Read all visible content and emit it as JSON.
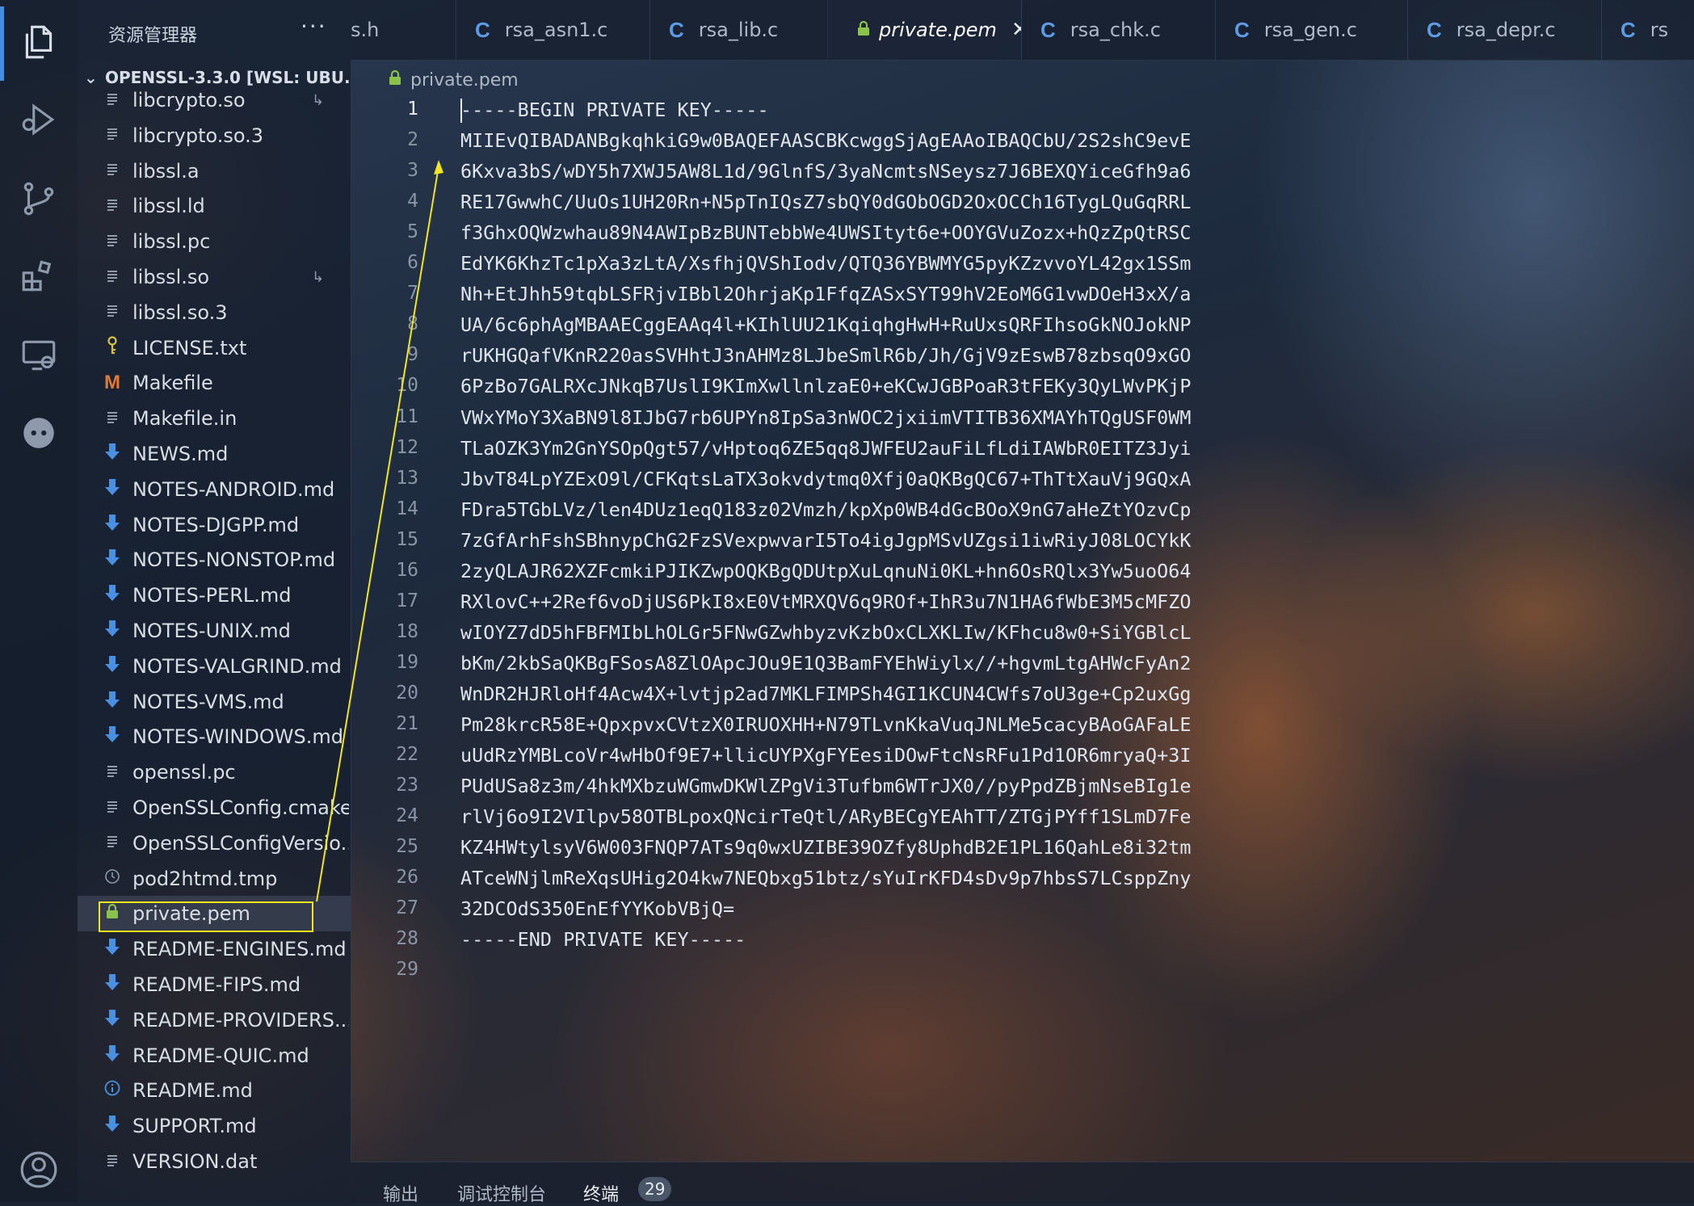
{
  "sidebar": {
    "title": "资源管理器",
    "more": "···",
    "workspace": "OPENSSL-3.3.0 [WSL: UBU...",
    "files": [
      {
        "name": "libcrypto.so",
        "icon": "text-file",
        "link": "↳"
      },
      {
        "name": "libcrypto.so.3",
        "icon": "text-file"
      },
      {
        "name": "libssl.a",
        "icon": "text-file"
      },
      {
        "name": "libssl.ld",
        "icon": "text-file"
      },
      {
        "name": "libssl.pc",
        "icon": "text-file"
      },
      {
        "name": "libssl.so",
        "icon": "text-file",
        "link": "↳"
      },
      {
        "name": "libssl.so.3",
        "icon": "text-file"
      },
      {
        "name": "LICENSE.txt",
        "icon": "license-key"
      },
      {
        "name": "Makefile",
        "icon": "makefile-m"
      },
      {
        "name": "Makefile.in",
        "icon": "text-file"
      },
      {
        "name": "NEWS.md",
        "icon": "markdown-arrow"
      },
      {
        "name": "NOTES-ANDROID.md",
        "icon": "markdown-arrow"
      },
      {
        "name": "NOTES-DJGPP.md",
        "icon": "markdown-arrow"
      },
      {
        "name": "NOTES-NONSTOP.md",
        "icon": "markdown-arrow"
      },
      {
        "name": "NOTES-PERL.md",
        "icon": "markdown-arrow"
      },
      {
        "name": "NOTES-UNIX.md",
        "icon": "markdown-arrow"
      },
      {
        "name": "NOTES-VALGRIND.md",
        "icon": "markdown-arrow"
      },
      {
        "name": "NOTES-VMS.md",
        "icon": "markdown-arrow"
      },
      {
        "name": "NOTES-WINDOWS.md",
        "icon": "markdown-arrow"
      },
      {
        "name": "openssl.pc",
        "icon": "text-file"
      },
      {
        "name": "OpenSSLConfig.cmake",
        "icon": "text-file"
      },
      {
        "name": "OpenSSLConfigVersio...",
        "icon": "text-file"
      },
      {
        "name": "pod2htmd.tmp",
        "icon": "clock"
      },
      {
        "name": "private.pem",
        "icon": "lock",
        "selected": true
      },
      {
        "name": "README-ENGINES.md",
        "icon": "markdown-arrow"
      },
      {
        "name": "README-FIPS.md",
        "icon": "markdown-arrow"
      },
      {
        "name": "README-PROVIDERS....",
        "icon": "markdown-arrow"
      },
      {
        "name": "README-QUIC.md",
        "icon": "markdown-arrow"
      },
      {
        "name": "README.md",
        "icon": "info"
      },
      {
        "name": "SUPPORT.md",
        "icon": "markdown-arrow"
      },
      {
        "name": "VERSION.dat",
        "icon": "text-file"
      }
    ]
  },
  "tabs": [
    {
      "label": "s.h",
      "c_icon": false
    },
    {
      "label": "rsa_asn1.c",
      "c_icon": true
    },
    {
      "label": "rsa_lib.c",
      "c_icon": true
    },
    {
      "label": "private.pem",
      "active": true,
      "lock": true,
      "close": "✕"
    },
    {
      "label": "rsa_chk.c",
      "c_icon": true
    },
    {
      "label": "rsa_gen.c",
      "c_icon": true
    },
    {
      "label": "rsa_depr.c",
      "c_icon": true
    },
    {
      "label": "rs",
      "c_icon": true
    }
  ],
  "breadcrumb": "private.pem",
  "editor": {
    "active_line": 1,
    "lines": [
      "-----BEGIN PRIVATE KEY-----",
      "MIIEvQIBADANBgkqhkiG9w0BAQEFAASCBKcwggSjAgEAAoIBAQCbU/2S2shC9evE",
      "6Kxva3bS/wDY5h7XWJ5AW8L1d/9GlnfS/3yaNcmtsNSeysz7J6BEXQYiceGfh9a6",
      "RE17GwwhC/UuOs1UH20Rn+N5pTnIQsZ7sbQY0dGObOGD2OxOCCh16TygLQuGqRRL",
      "f3GhxOQWzwhau89N4AWIpBzBUNTebbWe4UWSItyt6e+OOYGVuZozx+hQzZpQtRSC",
      "EdYK6KhzTc1pXa3zLtA/XsfhjQVShIodv/QTQ36YBWMYG5pyKZzvvoYL42gx1SSm",
      "Nh+EtJhh59tqbLSFRjvIBbl2OhrjaKp1FfqZASxSYT99hV2EoM6G1vwDOeH3xX/a",
      "UA/6c6phAgMBAAECggEAAq4l+KIhlUU21KqiqhgHwH+RuUxsQRFIhsoGkNOJokNP",
      "rUKHGQafVKnR220asSVHhtJ3nAHMz8LJbeSmlR6b/Jh/GjV9zEswB78zbsqO9xGO",
      "6PzBo7GALRXcJNkqB7UslI9KImXwllnlzaE0+eKCwJGBPoaR3tFEKy3QyLWvPKjP",
      "VWxYMoY3XaBN9l8IJbG7rb6UPYn8IpSa3nWOC2jxiimVTITB36XMAYhTQgUSF0WM",
      "TLaOZK3Ym2GnYSOpQgt57/vHptoq6ZE5qq8JWFEU2auFiLfLdiIAWbR0EITZ3Jyi",
      "JbvT84LpYZExO9l/CFKqtsLaTX3okvdytmq0Xfj0aQKBgQC67+ThTtXauVj9GQxA",
      "FDra5TGbLVz/len4DUz1eqQ183z02Vmzh/kpXp0WB4dGcBOoX9nG7aHeZtYOzvCp",
      "7zGfArhFshSBhnypChG2FzSVexpwvarI5To4igJgpMSvUZgsi1iwRiyJ08LOCYkK",
      "2zyQLAJR62XZFcmkiPJIKZwpOQKBgQDUtpXuLqnuNi0KL+hn6OsRQlx3Yw5uoO64",
      "RXlovC++2Ref6voDjUS6PkI8xE0VtMRXQV6q9ROf+IhR3u7N1HA6fWbE3M5cMFZO",
      "wIOYZ7dD5hFBFMIbLhOLGr5FNwGZwhbyzvKzbOxCLXKLIw/KFhcu8w0+SiYGBlcL",
      "bKm/2kbSaQKBgFSosA8ZlOApcJOu9E1Q3BamFYEhWiylx//+hgvmLtgAHWcFyAn2",
      "WnDR2HJRloHf4Acw4X+lvtjp2ad7MKLFIMPSh4GI1KCUN4CWfs7oU3ge+Cp2uxGg",
      "Pm28krcR58E+QpxpvxCVtzX0IRUOXHH+N79TLvnKkaVuqJNLMe5cacyBAoGAFaLE",
      "uUdRzYMBLcoVr4wHbOf9E7+llicUYPXgFYEesiDOwFtcNsRFu1Pd1OR6mryaQ+3I",
      "PUdUSa8z3m/4hkMXbzuWGmwDKWlZPgVi3Tufbm6WTrJX0//pyPpdZBjmNseBIg1e",
      "rlVj6o9I2VIlpv58OTBLpoxQNcirTeQtl/ARyBECgYEAhTT/ZTGjPYff1SLmD7Fe",
      "KZ4HWtylsyV6W003FNQP7ATs9q0wxUZIBE39OZfy8UphdB2E1PL16QahLe8i32tm",
      "ATceWNjlmReXqsUHig2O4kw7NEQbxg51btz/sYuIrKFD4sDv9p7hbsS7LCsppZny",
      "32DCOdS350EnEfYYKobVBjQ=",
      "-----END PRIVATE KEY-----",
      ""
    ]
  },
  "panel": {
    "tabs": [
      "输出",
      "调试控制台",
      "终端"
    ],
    "terminal_badge": "29"
  },
  "colors": {
    "accent": "#4a8cd8",
    "highlight_box": "#f3e61a",
    "c_icon": "#5c9ce6",
    "markdown_icon": "#4a90e2",
    "lock_icon": "#8bc34a",
    "makefile_icon": "#e37933"
  }
}
